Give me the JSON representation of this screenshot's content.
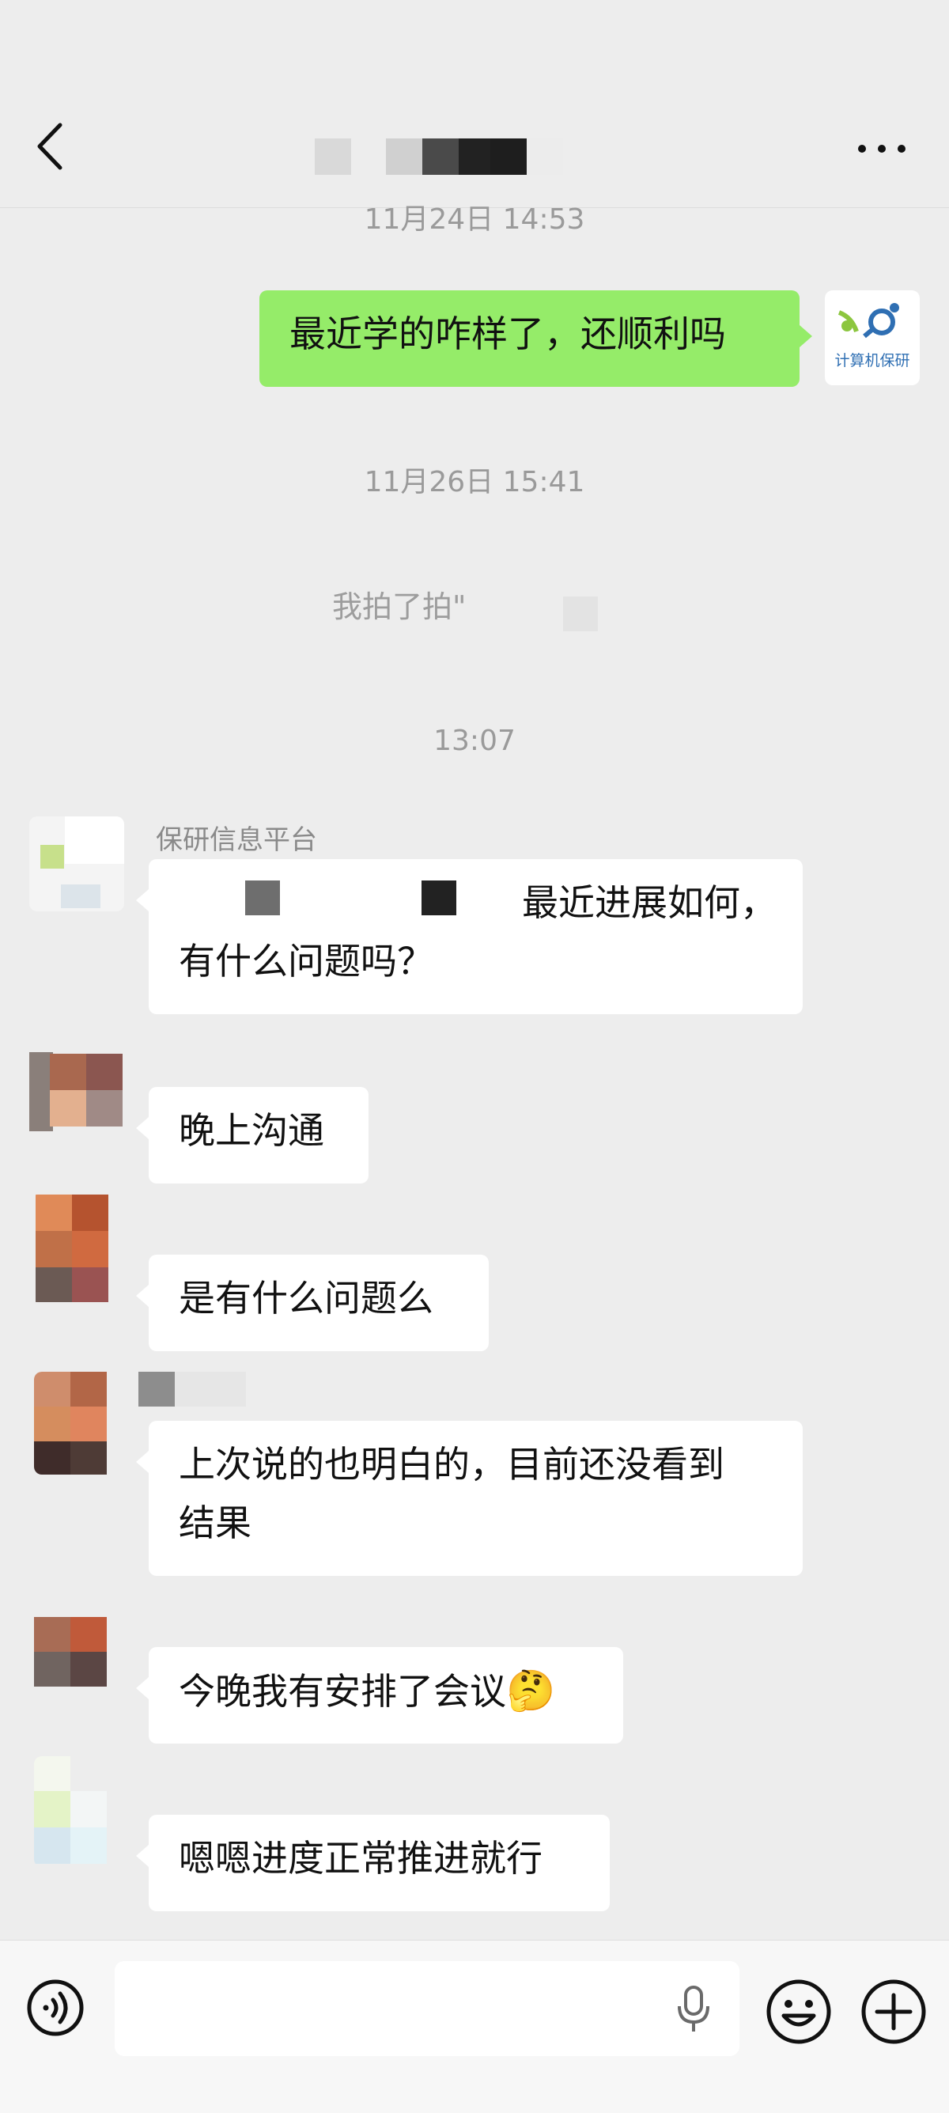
{
  "header": {
    "back_icon": "chevron-left-icon",
    "more_icon": "more-dots-icon"
  },
  "timestamps": {
    "t1": "11月24日 14:53",
    "t2": "11月26日 15:41",
    "t3": "13:07"
  },
  "messages": {
    "m1": "最近学的咋样了，还顺利吗",
    "sys": "我拍了拍\"",
    "m2_line1": "最近进展如何，",
    "m2_line2": "有什么问题吗？",
    "m3": "晚上沟通",
    "m4": "是有什么问题么",
    "m5_line1": "上次说的也明白的，目前还没看到",
    "m5_line2": "结果",
    "m6": "今晚我有安排了会议",
    "m6_emoji": "🤔",
    "m7": "嗯嗯进度正常推进就行"
  },
  "senders": {
    "platform": "保研信息平台"
  },
  "logo": {
    "text": "计算机保研",
    "brand_color": "#2f6fb3",
    "accent_color": "#8cc63f"
  },
  "colors": {
    "my_bubble": "#95ec69",
    "other_bubble": "#ffffff",
    "background": "#ededed"
  },
  "input_bar": {
    "voice_icon": "voice-icon",
    "mic_icon": "microphone-icon",
    "emoji_icon": "emoji-icon",
    "plus_icon": "plus-icon"
  }
}
